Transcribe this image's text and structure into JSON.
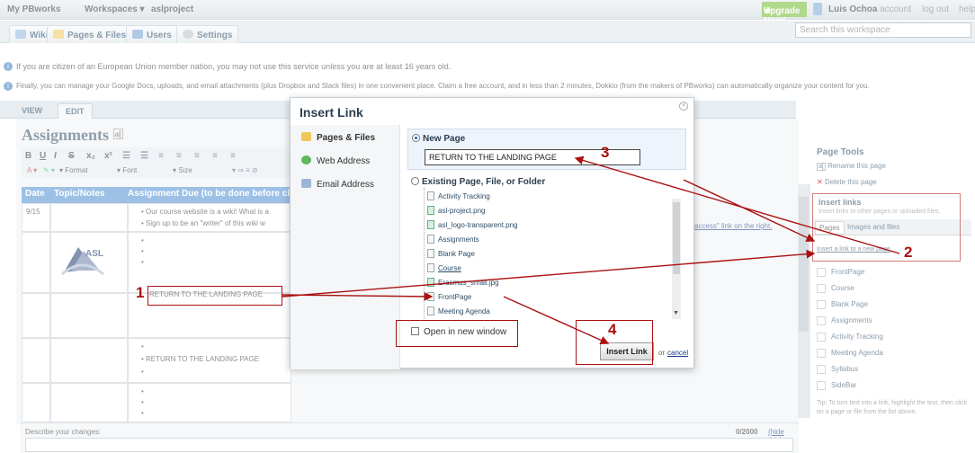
{
  "topbar": {
    "brand": "My PBworks",
    "workspaces": "Workspaces ▾",
    "project": "aslproject",
    "upgrade": "Upgrade Now!",
    "user": "Luis Ochoa",
    "account": "account",
    "logout": "log out",
    "help": "help"
  },
  "tabs": [
    "Wiki",
    "Pages & Files",
    "Users",
    "Settings"
  ],
  "search_placeholder": "Search this workspace",
  "notices": [
    "If you are citizen of an European Union member nation, you may not use this service unless you are at least 16 years old.",
    "Finally, you can manage your Google Docs, uploads, and email attachments (plus Dropbox and Slack files) in one convenient place. Claim a free account, and in less than 2 minutes, Dokkio (from the makers of PBworks) can automatically organize your content for you."
  ],
  "view_tab": "VIEW",
  "edit_tab": "EDIT",
  "page_title": "Assignments",
  "toolbar": {
    "bold": "B",
    "underline": "U",
    "italic": "I",
    "strike": "S",
    "format": "Format",
    "font": "Font",
    "size": "Size"
  },
  "table": {
    "headers": [
      "Date",
      "Topic/Notes",
      "Assignment Due (to be done before class)"
    ],
    "date1": "9/15",
    "bullet1": "Our course website is a wiki! What is a",
    "bullet2": "Sign up to be an \"writer\" of this wiki w",
    "link_frag": "access\" link on the right.",
    "return1": "RETURN TO THE LANDING PAGE",
    "return2": "RETURN TO THE LANDING PAGE",
    "logo": "ASL"
  },
  "describe": {
    "label": "Describe your changes:",
    "count": "0/2000",
    "hide": "(hide this)"
  },
  "right": {
    "page_tools": "Page Tools",
    "rename": "Rename this page",
    "delete": "Delete this page",
    "insert_links": "Insert links",
    "insert_sub": "Insert links to other pages or uploaded files.",
    "pages_tab": "Pages",
    "images_tab": "Images and files",
    "new_link": "Insert a link to a new page",
    "pages": [
      "FrontPage",
      "Course",
      "Blank Page",
      "Assignments",
      "Activity Tracking",
      "Meeting Agenda",
      "Syllabus",
      "SideBar"
    ],
    "tip": "Tip: To turn text into a link, highlight the text, then click on a page or file from the list above."
  },
  "dialog": {
    "title": "Insert Link",
    "left": [
      "Pages & Files",
      "Web Address",
      "Email Address"
    ],
    "new_page": "New Page",
    "input_value": "RETURN TO THE LANDING PAGE",
    "existing": "Existing Page, File, or Folder",
    "files": [
      "Activity Tracking",
      "asl-project.png",
      "asl_logo-transparent.png",
      "Assignments",
      "Blank Page",
      "Course",
      "Erasmus_small.jpg",
      "FrontPage",
      "Meeting Agenda"
    ],
    "open_new": "Open in new window",
    "insert_btn": "Insert Link",
    "or": "or",
    "cancel": "cancel"
  },
  "annotations": [
    "1",
    "2",
    "3",
    "4"
  ],
  "colors": {
    "accent": "#4d8fd1",
    "annotation": "#aa1111",
    "upgrade": "#6fbb2c"
  }
}
